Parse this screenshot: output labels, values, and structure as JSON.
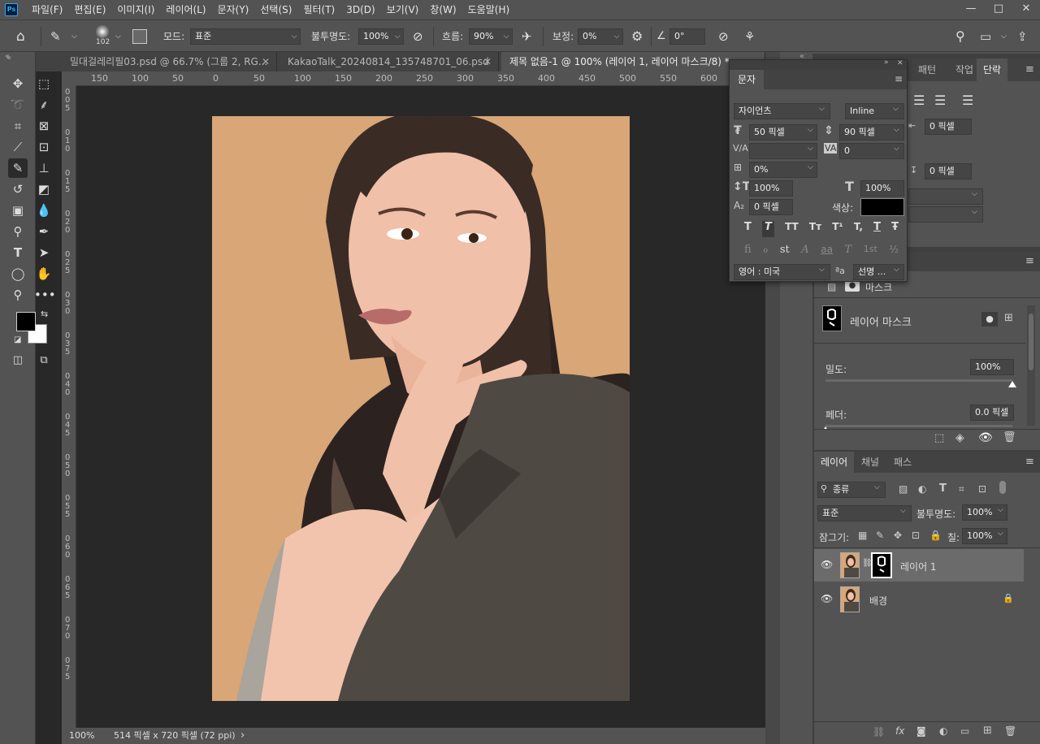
{
  "app": {
    "logo": "Ps"
  },
  "menu": [
    "파일(F)",
    "편집(E)",
    "이미지(I)",
    "레이어(L)",
    "문자(Y)",
    "선택(S)",
    "필터(T)",
    "3D(D)",
    "보기(V)",
    "창(W)",
    "도움말(H)"
  ],
  "window_controls": {
    "minimize": "—",
    "maximize": "□",
    "close": "✕"
  },
  "options": {
    "brush_size": "102",
    "mode_label": "모드:",
    "mode_value": "표준",
    "opacity_label": "불투명도:",
    "opacity_value": "100%",
    "flow_label": "흐름:",
    "flow_value": "90%",
    "smoothing_label": "보정:",
    "smoothing_value": "0%",
    "angle_value": "0°"
  },
  "tabs": [
    {
      "label": "밀대걸레리필03.psd @ 66.7% (그룹 2, RG...",
      "close": "✕"
    },
    {
      "label": "KakaoTalk_20240814_135748701_06.psd @...",
      "close": "✕"
    },
    {
      "label": "제목 없음-1 @ 100% (레이어 1, 레이어 마스크/8) *",
      "close": "✕"
    }
  ],
  "ruler_h": [
    "150",
    "100",
    "50",
    "0",
    "50",
    "100",
    "150",
    "200",
    "250",
    "300",
    "350",
    "400",
    "450",
    "500",
    "550",
    "600"
  ],
  "ruler_v": [
    "0",
    "0",
    "5",
    "0",
    "1",
    "0",
    "0",
    "1",
    "5",
    "0",
    "2",
    "0",
    "0",
    "2",
    "5",
    "0",
    "3",
    "0",
    "0",
    "3",
    "5",
    "0",
    "4",
    "0",
    "0",
    "4",
    "5",
    "0",
    "5",
    "0",
    "0",
    "5",
    "5",
    "0",
    "6",
    "0",
    "0",
    "6",
    "5",
    "0",
    "7",
    "0",
    "0",
    "7",
    "5"
  ],
  "status": {
    "zoom": "100%",
    "info": "514 픽셀 x 720 픽셀 (72 ppi)",
    "arrow": "›"
  },
  "character_panel": {
    "title": "문자",
    "font_family": "자이언츠",
    "font_style": "Inline",
    "font_size": "50 픽셀",
    "leading": "90 픽셀",
    "kerning": "",
    "tracking": "0",
    "tsume": "0%",
    "vscale": "100%",
    "hscale": "100%",
    "baseline": "0 픽셀",
    "color_label": "색상:",
    "color_value": "#000000",
    "style_buttons": [
      "T",
      "T",
      "TT",
      "Tт",
      "T¹",
      "T,",
      "T",
      "Ŧ"
    ],
    "opentype_buttons": [
      "fi",
      "ℴ",
      "st",
      "A",
      "aa",
      "T",
      "1st",
      "½"
    ],
    "language": "영어 : 미국",
    "antialias_icon": "ªa",
    "antialias": "선명 ..."
  },
  "paragraph_panel": {
    "tabs": [
      "패턴",
      "작업 내",
      "단락"
    ],
    "indent_right": "0 픽셀",
    "space_after": "0 픽셀"
  },
  "properties_panel": {
    "layer_mask_label": "마스크",
    "mask_title": "레이어 마스크",
    "density_label": "밀도:",
    "density_value": "100%",
    "density_fraction": 1.0,
    "feather_label": "페더:",
    "feather_value": "0.0 픽셀",
    "feather_fraction": 0.0
  },
  "layers_panel": {
    "tabs": [
      "레이어",
      "채널",
      "패스"
    ],
    "filter_kind": "종류",
    "blend_mode": "표준",
    "opacity_label": "불투명도:",
    "opacity_value": "100%",
    "lock_label": "잠그기:",
    "fill_label": "칠:",
    "fill_value": "100%",
    "layers": [
      {
        "name": "레이어 1"
      },
      {
        "name": "배경"
      }
    ]
  }
}
